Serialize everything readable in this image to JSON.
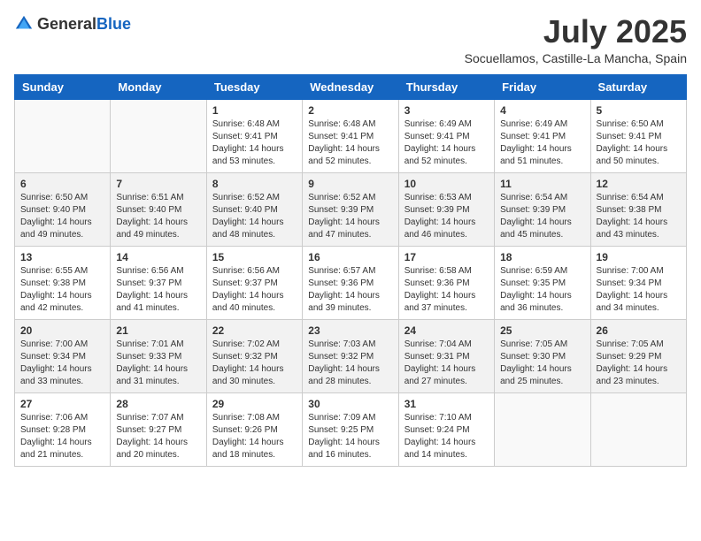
{
  "header": {
    "logo_general": "General",
    "logo_blue": "Blue",
    "month_title": "July 2025",
    "subtitle": "Socuellamos, Castille-La Mancha, Spain"
  },
  "weekdays": [
    "Sunday",
    "Monday",
    "Tuesday",
    "Wednesday",
    "Thursday",
    "Friday",
    "Saturday"
  ],
  "weeks": [
    [
      {
        "day": "",
        "sunrise": "",
        "sunset": "",
        "daylight": ""
      },
      {
        "day": "",
        "sunrise": "",
        "sunset": "",
        "daylight": ""
      },
      {
        "day": "1",
        "sunrise": "Sunrise: 6:48 AM",
        "sunset": "Sunset: 9:41 PM",
        "daylight": "Daylight: 14 hours and 53 minutes."
      },
      {
        "day": "2",
        "sunrise": "Sunrise: 6:48 AM",
        "sunset": "Sunset: 9:41 PM",
        "daylight": "Daylight: 14 hours and 52 minutes."
      },
      {
        "day": "3",
        "sunrise": "Sunrise: 6:49 AM",
        "sunset": "Sunset: 9:41 PM",
        "daylight": "Daylight: 14 hours and 52 minutes."
      },
      {
        "day": "4",
        "sunrise": "Sunrise: 6:49 AM",
        "sunset": "Sunset: 9:41 PM",
        "daylight": "Daylight: 14 hours and 51 minutes."
      },
      {
        "day": "5",
        "sunrise": "Sunrise: 6:50 AM",
        "sunset": "Sunset: 9:41 PM",
        "daylight": "Daylight: 14 hours and 50 minutes."
      }
    ],
    [
      {
        "day": "6",
        "sunrise": "Sunrise: 6:50 AM",
        "sunset": "Sunset: 9:40 PM",
        "daylight": "Daylight: 14 hours and 49 minutes."
      },
      {
        "day": "7",
        "sunrise": "Sunrise: 6:51 AM",
        "sunset": "Sunset: 9:40 PM",
        "daylight": "Daylight: 14 hours and 49 minutes."
      },
      {
        "day": "8",
        "sunrise": "Sunrise: 6:52 AM",
        "sunset": "Sunset: 9:40 PM",
        "daylight": "Daylight: 14 hours and 48 minutes."
      },
      {
        "day": "9",
        "sunrise": "Sunrise: 6:52 AM",
        "sunset": "Sunset: 9:39 PM",
        "daylight": "Daylight: 14 hours and 47 minutes."
      },
      {
        "day": "10",
        "sunrise": "Sunrise: 6:53 AM",
        "sunset": "Sunset: 9:39 PM",
        "daylight": "Daylight: 14 hours and 46 minutes."
      },
      {
        "day": "11",
        "sunrise": "Sunrise: 6:54 AM",
        "sunset": "Sunset: 9:39 PM",
        "daylight": "Daylight: 14 hours and 45 minutes."
      },
      {
        "day": "12",
        "sunrise": "Sunrise: 6:54 AM",
        "sunset": "Sunset: 9:38 PM",
        "daylight": "Daylight: 14 hours and 43 minutes."
      }
    ],
    [
      {
        "day": "13",
        "sunrise": "Sunrise: 6:55 AM",
        "sunset": "Sunset: 9:38 PM",
        "daylight": "Daylight: 14 hours and 42 minutes."
      },
      {
        "day": "14",
        "sunrise": "Sunrise: 6:56 AM",
        "sunset": "Sunset: 9:37 PM",
        "daylight": "Daylight: 14 hours and 41 minutes."
      },
      {
        "day": "15",
        "sunrise": "Sunrise: 6:56 AM",
        "sunset": "Sunset: 9:37 PM",
        "daylight": "Daylight: 14 hours and 40 minutes."
      },
      {
        "day": "16",
        "sunrise": "Sunrise: 6:57 AM",
        "sunset": "Sunset: 9:36 PM",
        "daylight": "Daylight: 14 hours and 39 minutes."
      },
      {
        "day": "17",
        "sunrise": "Sunrise: 6:58 AM",
        "sunset": "Sunset: 9:36 PM",
        "daylight": "Daylight: 14 hours and 37 minutes."
      },
      {
        "day": "18",
        "sunrise": "Sunrise: 6:59 AM",
        "sunset": "Sunset: 9:35 PM",
        "daylight": "Daylight: 14 hours and 36 minutes."
      },
      {
        "day": "19",
        "sunrise": "Sunrise: 7:00 AM",
        "sunset": "Sunset: 9:34 PM",
        "daylight": "Daylight: 14 hours and 34 minutes."
      }
    ],
    [
      {
        "day": "20",
        "sunrise": "Sunrise: 7:00 AM",
        "sunset": "Sunset: 9:34 PM",
        "daylight": "Daylight: 14 hours and 33 minutes."
      },
      {
        "day": "21",
        "sunrise": "Sunrise: 7:01 AM",
        "sunset": "Sunset: 9:33 PM",
        "daylight": "Daylight: 14 hours and 31 minutes."
      },
      {
        "day": "22",
        "sunrise": "Sunrise: 7:02 AM",
        "sunset": "Sunset: 9:32 PM",
        "daylight": "Daylight: 14 hours and 30 minutes."
      },
      {
        "day": "23",
        "sunrise": "Sunrise: 7:03 AM",
        "sunset": "Sunset: 9:32 PM",
        "daylight": "Daylight: 14 hours and 28 minutes."
      },
      {
        "day": "24",
        "sunrise": "Sunrise: 7:04 AM",
        "sunset": "Sunset: 9:31 PM",
        "daylight": "Daylight: 14 hours and 27 minutes."
      },
      {
        "day": "25",
        "sunrise": "Sunrise: 7:05 AM",
        "sunset": "Sunset: 9:30 PM",
        "daylight": "Daylight: 14 hours and 25 minutes."
      },
      {
        "day": "26",
        "sunrise": "Sunrise: 7:05 AM",
        "sunset": "Sunset: 9:29 PM",
        "daylight": "Daylight: 14 hours and 23 minutes."
      }
    ],
    [
      {
        "day": "27",
        "sunrise": "Sunrise: 7:06 AM",
        "sunset": "Sunset: 9:28 PM",
        "daylight": "Daylight: 14 hours and 21 minutes."
      },
      {
        "day": "28",
        "sunrise": "Sunrise: 7:07 AM",
        "sunset": "Sunset: 9:27 PM",
        "daylight": "Daylight: 14 hours and 20 minutes."
      },
      {
        "day": "29",
        "sunrise": "Sunrise: 7:08 AM",
        "sunset": "Sunset: 9:26 PM",
        "daylight": "Daylight: 14 hours and 18 minutes."
      },
      {
        "day": "30",
        "sunrise": "Sunrise: 7:09 AM",
        "sunset": "Sunset: 9:25 PM",
        "daylight": "Daylight: 14 hours and 16 minutes."
      },
      {
        "day": "31",
        "sunrise": "Sunrise: 7:10 AM",
        "sunset": "Sunset: 9:24 PM",
        "daylight": "Daylight: 14 hours and 14 minutes."
      },
      {
        "day": "",
        "sunrise": "",
        "sunset": "",
        "daylight": ""
      },
      {
        "day": "",
        "sunrise": "",
        "sunset": "",
        "daylight": ""
      }
    ]
  ]
}
